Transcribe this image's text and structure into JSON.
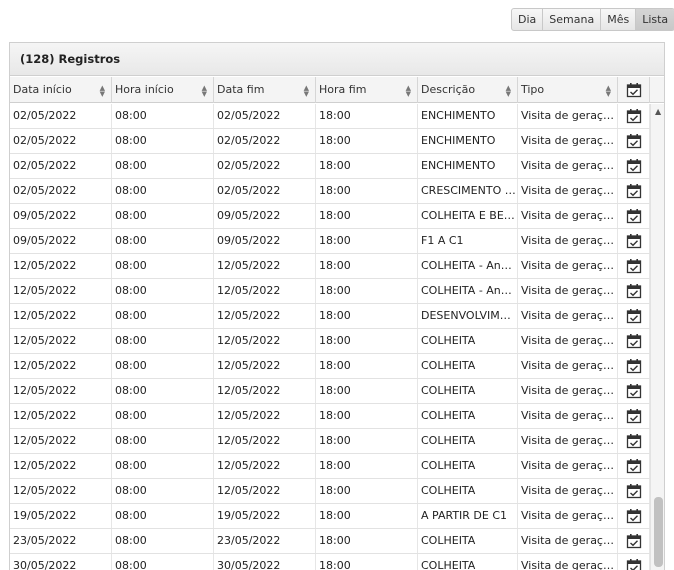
{
  "view_switch": {
    "buttons": [
      {
        "label": "Dia",
        "active": false
      },
      {
        "label": "Semana",
        "active": false
      },
      {
        "label": "Mês",
        "active": false
      },
      {
        "label": "Lista",
        "active": true
      }
    ]
  },
  "panel": {
    "title": "(128) Registros"
  },
  "table": {
    "columns": [
      "Data início",
      "Hora início",
      "Data fim",
      "Hora fim",
      "Descrição",
      "Tipo"
    ],
    "action_icon": "calendar-check-icon",
    "rows": [
      {
        "data_inicio": "02/05/2022",
        "hora_inicio": "08:00",
        "data_fim": "02/05/2022",
        "hora_fim": "18:00",
        "descricao": "ENCHIMENTO",
        "tipo": "Visita de geração ..."
      },
      {
        "data_inicio": "02/05/2022",
        "hora_inicio": "08:00",
        "data_fim": "02/05/2022",
        "hora_fim": "18:00",
        "descricao": "ENCHIMENTO",
        "tipo": "Visita de geração ..."
      },
      {
        "data_inicio": "02/05/2022",
        "hora_inicio": "08:00",
        "data_fim": "02/05/2022",
        "hora_fim": "18:00",
        "descricao": "ENCHIMENTO",
        "tipo": "Visita de geração ..."
      },
      {
        "data_inicio": "02/05/2022",
        "hora_inicio": "08:00",
        "data_fim": "02/05/2022",
        "hora_fim": "18:00",
        "descricao": "CRESCIMENTO R...",
        "tipo": "Visita de geração ..."
      },
      {
        "data_inicio": "09/05/2022",
        "hora_inicio": "08:00",
        "data_fim": "09/05/2022",
        "hora_fim": "18:00",
        "descricao": "COLHEITA E BEN...",
        "tipo": "Visita de geração ..."
      },
      {
        "data_inicio": "09/05/2022",
        "hora_inicio": "08:00",
        "data_fim": "09/05/2022",
        "hora_fim": "18:00",
        "descricao": "F1 A C1",
        "tipo": "Visita de geração ..."
      },
      {
        "data_inicio": "12/05/2022",
        "hora_inicio": "08:00",
        "data_fim": "12/05/2022",
        "hora_fim": "18:00",
        "descricao": "COLHEITA - Andr...",
        "tipo": "Visita de geração ..."
      },
      {
        "data_inicio": "12/05/2022",
        "hora_inicio": "08:00",
        "data_fim": "12/05/2022",
        "hora_fim": "18:00",
        "descricao": "COLHEITA - Andr...",
        "tipo": "Visita de geração ..."
      },
      {
        "data_inicio": "12/05/2022",
        "hora_inicio": "08:00",
        "data_fim": "12/05/2022",
        "hora_fim": "18:00",
        "descricao": "DESENVOLVIMEN...",
        "tipo": "Visita de geração ..."
      },
      {
        "data_inicio": "12/05/2022",
        "hora_inicio": "08:00",
        "data_fim": "12/05/2022",
        "hora_fim": "18:00",
        "descricao": "COLHEITA",
        "tipo": "Visita de geração ..."
      },
      {
        "data_inicio": "12/05/2022",
        "hora_inicio": "08:00",
        "data_fim": "12/05/2022",
        "hora_fim": "18:00",
        "descricao": "COLHEITA",
        "tipo": "Visita de geração ..."
      },
      {
        "data_inicio": "12/05/2022",
        "hora_inicio": "08:00",
        "data_fim": "12/05/2022",
        "hora_fim": "18:00",
        "descricao": "COLHEITA",
        "tipo": "Visita de geração ..."
      },
      {
        "data_inicio": "12/05/2022",
        "hora_inicio": "08:00",
        "data_fim": "12/05/2022",
        "hora_fim": "18:00",
        "descricao": "COLHEITA",
        "tipo": "Visita de geração ..."
      },
      {
        "data_inicio": "12/05/2022",
        "hora_inicio": "08:00",
        "data_fim": "12/05/2022",
        "hora_fim": "18:00",
        "descricao": "COLHEITA",
        "tipo": "Visita de geração ..."
      },
      {
        "data_inicio": "12/05/2022",
        "hora_inicio": "08:00",
        "data_fim": "12/05/2022",
        "hora_fim": "18:00",
        "descricao": "COLHEITA",
        "tipo": "Visita de geração ..."
      },
      {
        "data_inicio": "12/05/2022",
        "hora_inicio": "08:00",
        "data_fim": "12/05/2022",
        "hora_fim": "18:00",
        "descricao": "COLHEITA",
        "tipo": "Visita de geração ..."
      },
      {
        "data_inicio": "19/05/2022",
        "hora_inicio": "08:00",
        "data_fim": "19/05/2022",
        "hora_fim": "18:00",
        "descricao": "A PARTIR DE C1",
        "tipo": "Visita de geração ..."
      },
      {
        "data_inicio": "23/05/2022",
        "hora_inicio": "08:00",
        "data_fim": "23/05/2022",
        "hora_fim": "18:00",
        "descricao": "COLHEITA",
        "tipo": "Visita de geração ..."
      },
      {
        "data_inicio": "30/05/2022",
        "hora_inicio": "08:00",
        "data_fim": "30/05/2022",
        "hora_fim": "18:00",
        "descricao": "COLHEITA",
        "tipo": "Visita de geração ..."
      }
    ]
  }
}
